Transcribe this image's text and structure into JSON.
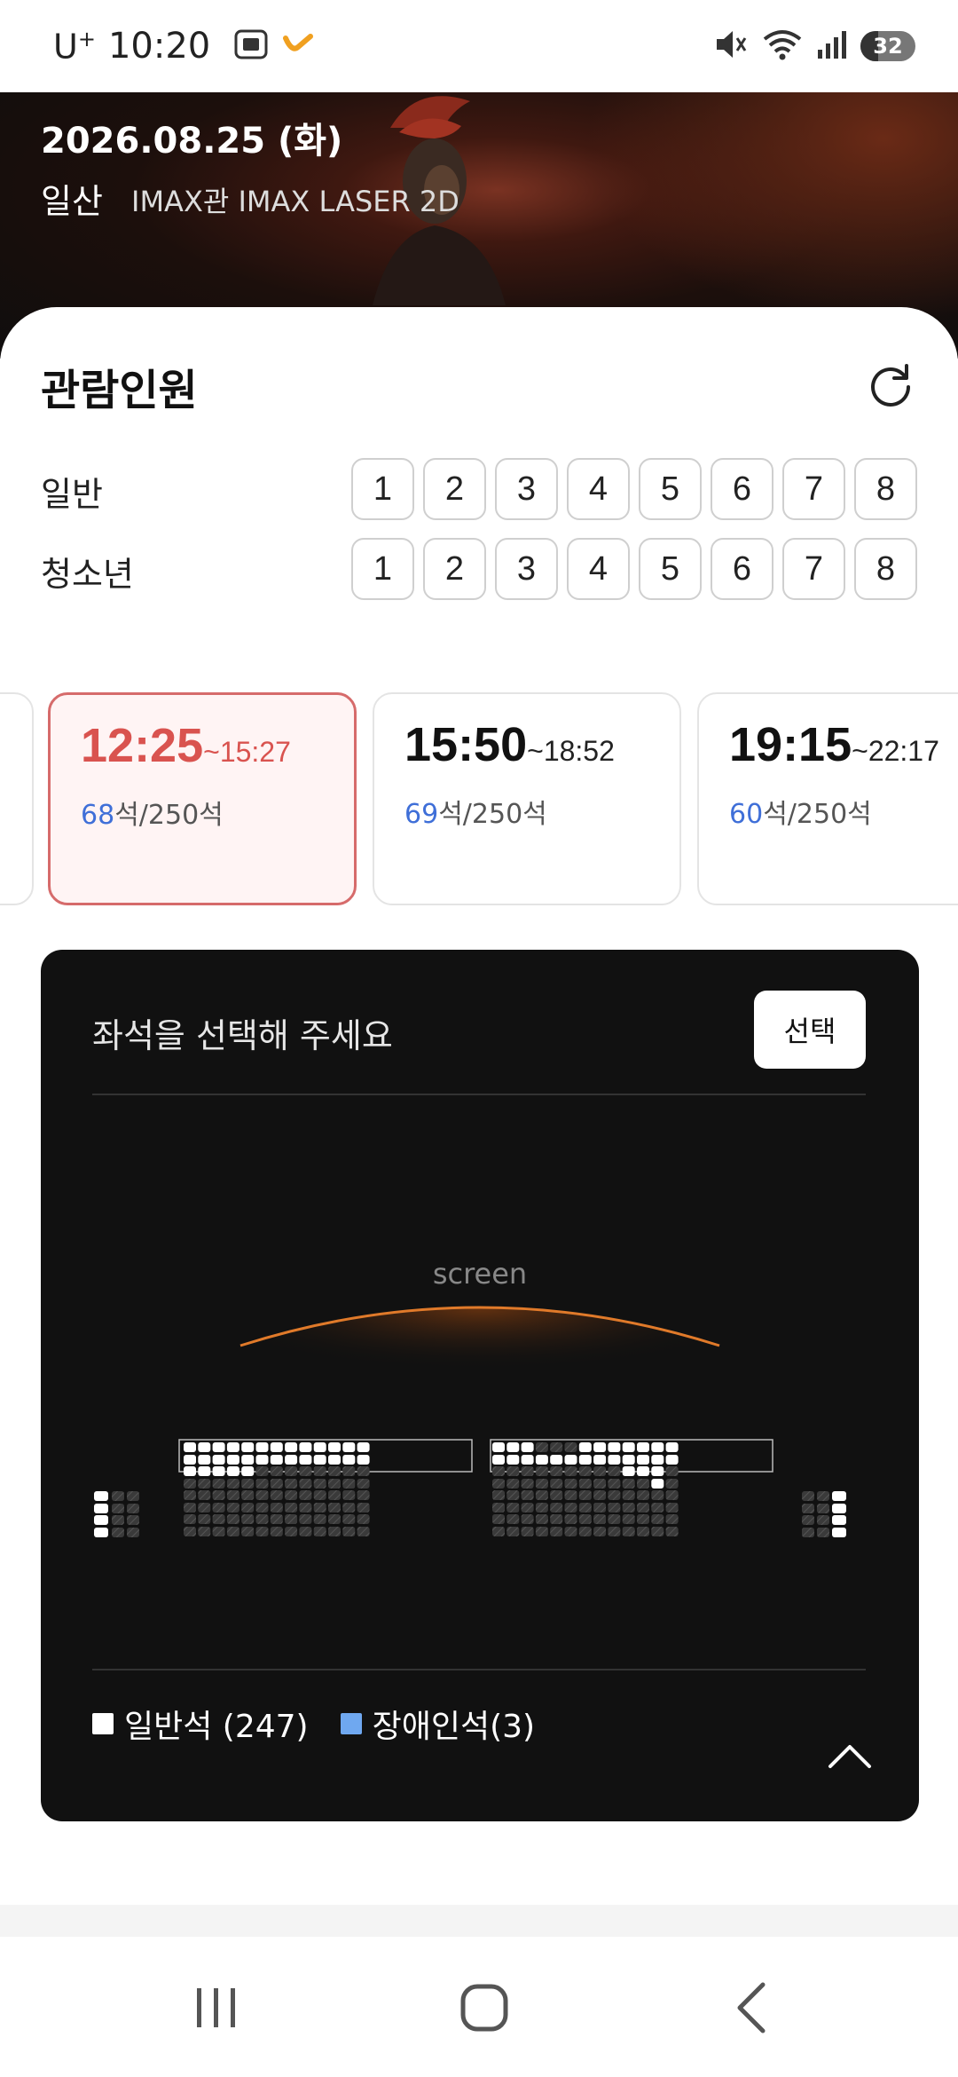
{
  "status_bar": {
    "carrier": "U",
    "carrier_sup": "+",
    "time": "10:20",
    "battery": "32",
    "battery_level": 0.32,
    "icons": [
      "screenshot-icon",
      "notification-icon",
      "mute-icon",
      "wifi-icon",
      "signal-icon",
      "battery-icon"
    ]
  },
  "header": {
    "date": "2026.08.25 (화)",
    "location": "일산",
    "hall": "IMAX관 IMAX LASER 2D"
  },
  "audience": {
    "title": "관람인원",
    "rows": [
      {
        "label": "일반",
        "options": [
          "1",
          "2",
          "3",
          "4",
          "5",
          "6",
          "7",
          "8"
        ]
      },
      {
        "label": "청소년",
        "options": [
          "1",
          "2",
          "3",
          "4",
          "5",
          "6",
          "7",
          "8"
        ]
      }
    ]
  },
  "showtimes": [
    {
      "start": "12:25",
      "end": "~15:27",
      "available": "68",
      "total": "석/250석",
      "selected": true
    },
    {
      "start": "15:50",
      "end": "~18:52",
      "available": "69",
      "total": "석/250석",
      "selected": false
    },
    {
      "start": "19:15",
      "end": "~22:17",
      "available": "60",
      "total": "석/250석",
      "selected": false
    }
  ],
  "seat_panel": {
    "prompt": "좌석을 선택해 주세요",
    "select_label": "선택",
    "screen_label": "screen",
    "legend": [
      {
        "label": "일반석 (247)",
        "color": "#ffffff"
      },
      {
        "label": "장애인석(3)",
        "color": "#6fa8f0"
      }
    ]
  },
  "colors": {
    "accent": "#d9534f",
    "available_count": "#3f6fd8",
    "seat_available": "#ffffff",
    "seat_taken": "#3a3a3a"
  }
}
